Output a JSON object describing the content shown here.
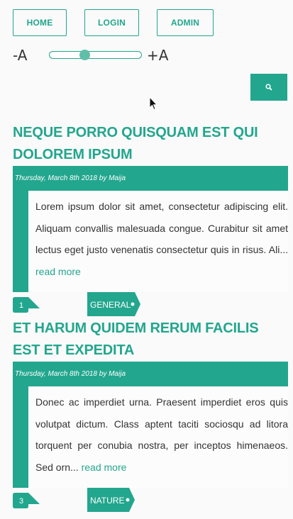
{
  "nav": {
    "home": "HOME",
    "login": "LOGIN",
    "admin": "ADMIN"
  },
  "font_size": {
    "decrease": "-A",
    "increase": "+A",
    "level": 0.37
  },
  "search": {
    "button_icon": "search-icon"
  },
  "posts": [
    {
      "title": "NEQUE PORRO QUISQUAM EST QUI DOLOREM IPSUM",
      "meta": "Thursday, March 8th 2018 by Maija",
      "excerpt": "Lorem ipsum dolor sit amet, consectetur adipiscing elit. Aliquam convallis malesuada congue. Curabitur sit amet lectus eget justo venenatis consectetur quis in risus. Ali...",
      "read_more": "read more",
      "comments": "1",
      "tag": "GENERAL"
    },
    {
      "title": "ET HARUM QUIDEM RERUM FACILIS EST ET EXPEDITA",
      "meta": "Thursday, March 8th 2018 by Maija",
      "excerpt": "Donec ac imperdiet urna. Praesent imperdiet eros quis volutpat dictum. Class aptent taciti sociosqu ad litora torquent per conubia nostra, per inceptos himenaeos. Sed orn...",
      "read_more": "read more",
      "comments": "3",
      "tag": "NATURE"
    }
  ],
  "colors": {
    "accent": "#23a68e",
    "background": "#f9faf9"
  }
}
